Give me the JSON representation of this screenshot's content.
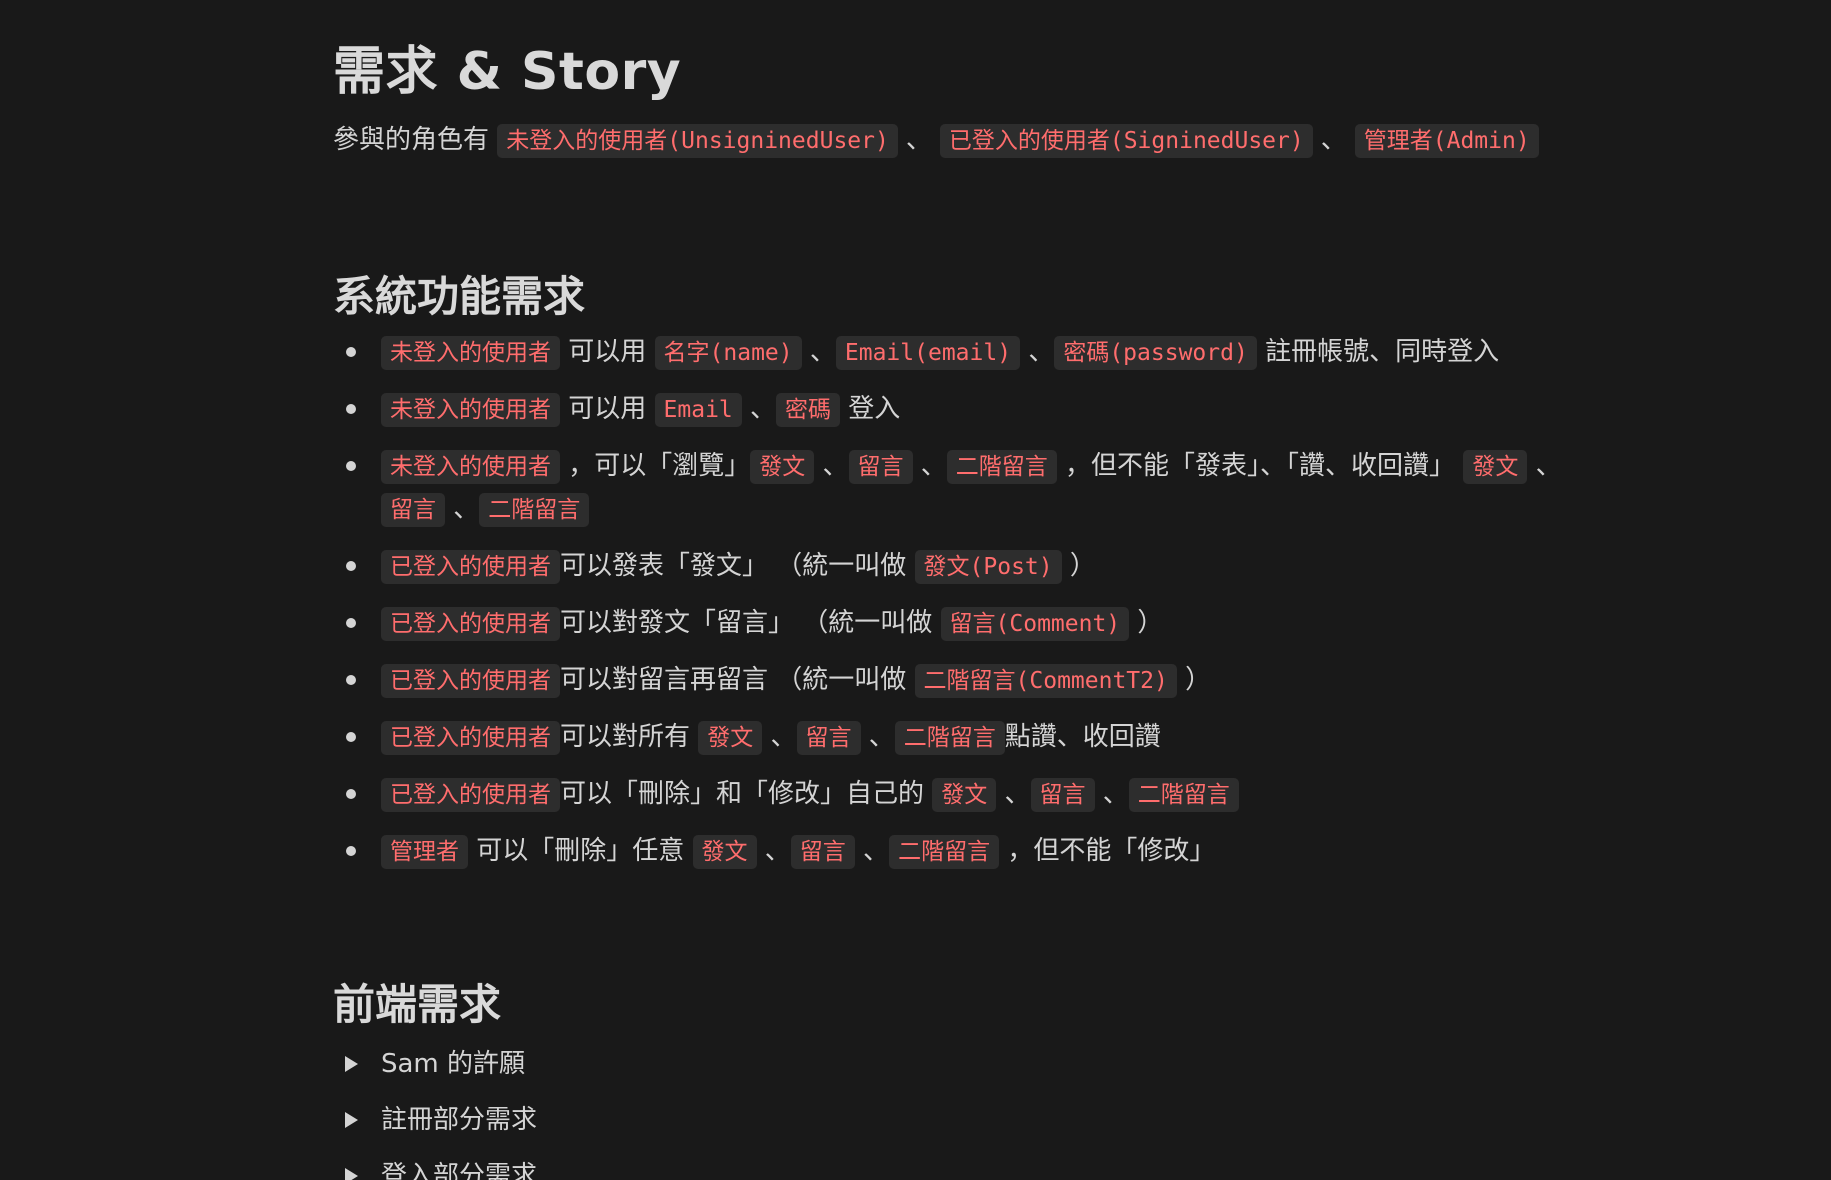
{
  "page": {
    "title": "需求 & Story",
    "intro": {
      "prefix": "參與的角色有",
      "roles": [
        "未登入的使用者(UnsigninedUser)",
        "已登入的使用者(SigninedUser)",
        "管理者(Admin)"
      ],
      "separator": "、"
    }
  },
  "system_section": {
    "heading": "系統功能需求",
    "items": [
      [
        "未登入的使用者",
        " 可以用 ",
        "名字(name)",
        " 、",
        "Email(email)",
        " 、",
        "密碼(password)",
        " 註冊帳號、同時登入"
      ],
      [
        "未登入的使用者",
        " 可以用 ",
        "Email",
        " 、",
        "密碼",
        " 登入"
      ],
      [
        "未登入的使用者",
        " ，可以「瀏覽」",
        "發文",
        " 、",
        "留言",
        " 、",
        "二階留言",
        " ，但不能「發表」、「讚、收回讚」 ",
        "發文",
        " 、",
        "留言",
        " 、",
        "二階留言"
      ],
      [
        "已登入的使用者",
        "可以發表「發文」 （統一叫做 ",
        "發文(Post)",
        " ）"
      ],
      [
        "已登入的使用者",
        "可以對發文「留言」 （統一叫做 ",
        "留言(Comment)",
        " ）"
      ],
      [
        "已登入的使用者",
        "可以對留言再留言 （統一叫做 ",
        "二階留言(CommentT2)",
        " ）"
      ],
      [
        "已登入的使用者",
        "可以對所有 ",
        "發文",
        " 、",
        "留言",
        " 、",
        "二階留言",
        "點讚、收回讚"
      ],
      [
        "已登入的使用者",
        "可以「刪除」和「修改」自己的 ",
        "發文",
        " 、",
        "留言",
        " 、",
        "二階留言"
      ],
      [
        "管理者",
        " 可以「刪除」任意 ",
        "發文",
        " 、",
        "留言",
        " 、",
        "二階留言",
        " ，但不能「修改」"
      ]
    ]
  },
  "frontend_section": {
    "heading": "前端需求",
    "toggles": [
      "Sam 的許願",
      "註冊部分需求",
      "登入部分需求"
    ]
  },
  "colors": {
    "background": "#191919",
    "text": "#d4d4d4",
    "tag_text": "#ff6d6d",
    "tag_background": "#2d2d2d"
  },
  "icons": {
    "bullet": "bullet-dot-icon",
    "toggle": "toggle-triangle-icon"
  }
}
